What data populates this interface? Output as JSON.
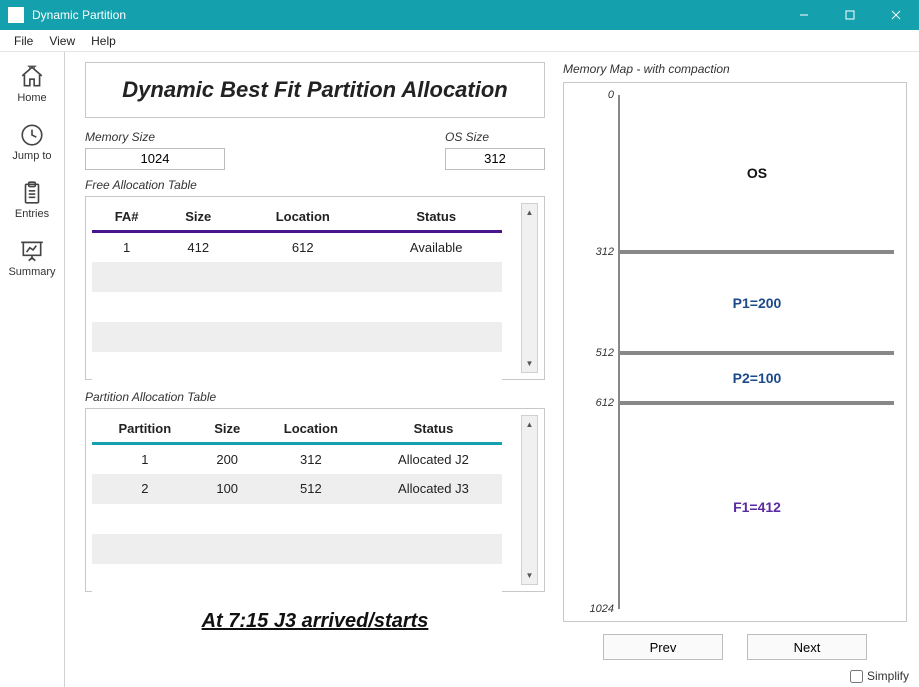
{
  "window": {
    "title": "Dynamic Partition"
  },
  "menubar": {
    "file": "File",
    "view": "View",
    "help": "Help"
  },
  "rail": {
    "home": "Home",
    "jumpto": "Jump to",
    "entries": "Entries",
    "summary": "Summary"
  },
  "heading": "Dynamic Best Fit Partition Allocation",
  "memory": {
    "label": "Memory Size",
    "value": "1024"
  },
  "os": {
    "label": "OS Size",
    "value": "312"
  },
  "fat": {
    "label": "Free Allocation Table",
    "cols": {
      "c0": "FA#",
      "c1": "Size",
      "c2": "Location",
      "c3": "Status"
    },
    "rows": [
      {
        "c0": "1",
        "c1": "412",
        "c2": "612",
        "c3": "Available"
      },
      {
        "c0": "",
        "c1": "",
        "c2": "",
        "c3": ""
      },
      {
        "c0": "",
        "c1": "",
        "c2": "",
        "c3": ""
      },
      {
        "c0": "",
        "c1": "",
        "c2": "",
        "c3": ""
      },
      {
        "c0": "",
        "c1": "",
        "c2": "",
        "c3": ""
      }
    ]
  },
  "pat": {
    "label": "Partition Allocation Table",
    "cols": {
      "c0": "Partition",
      "c1": "Size",
      "c2": "Location",
      "c3": "Status"
    },
    "rows": [
      {
        "c0": "1",
        "c1": "200",
        "c2": "312",
        "c3": "Allocated J2"
      },
      {
        "c0": "2",
        "c1": "100",
        "c2": "512",
        "c3": "Allocated J3"
      },
      {
        "c0": "",
        "c1": "",
        "c2": "",
        "c3": ""
      },
      {
        "c0": "",
        "c1": "",
        "c2": "",
        "c3": ""
      },
      {
        "c0": "",
        "c1": "",
        "c2": "",
        "c3": ""
      }
    ]
  },
  "status_line": "At 7:15 J3 arrived/starts",
  "map": {
    "label": "Memory Map - with compaction",
    "ticks": {
      "t0": "0",
      "t1": "312",
      "t2": "512",
      "t3": "612",
      "t4": "1024"
    },
    "blocks": {
      "os": "OS",
      "p1": "P1=200",
      "p2": "P2=100",
      "f1": "F1=412"
    }
  },
  "nav": {
    "prev": "Prev",
    "next": "Next"
  },
  "simplify": "Simplify"
}
